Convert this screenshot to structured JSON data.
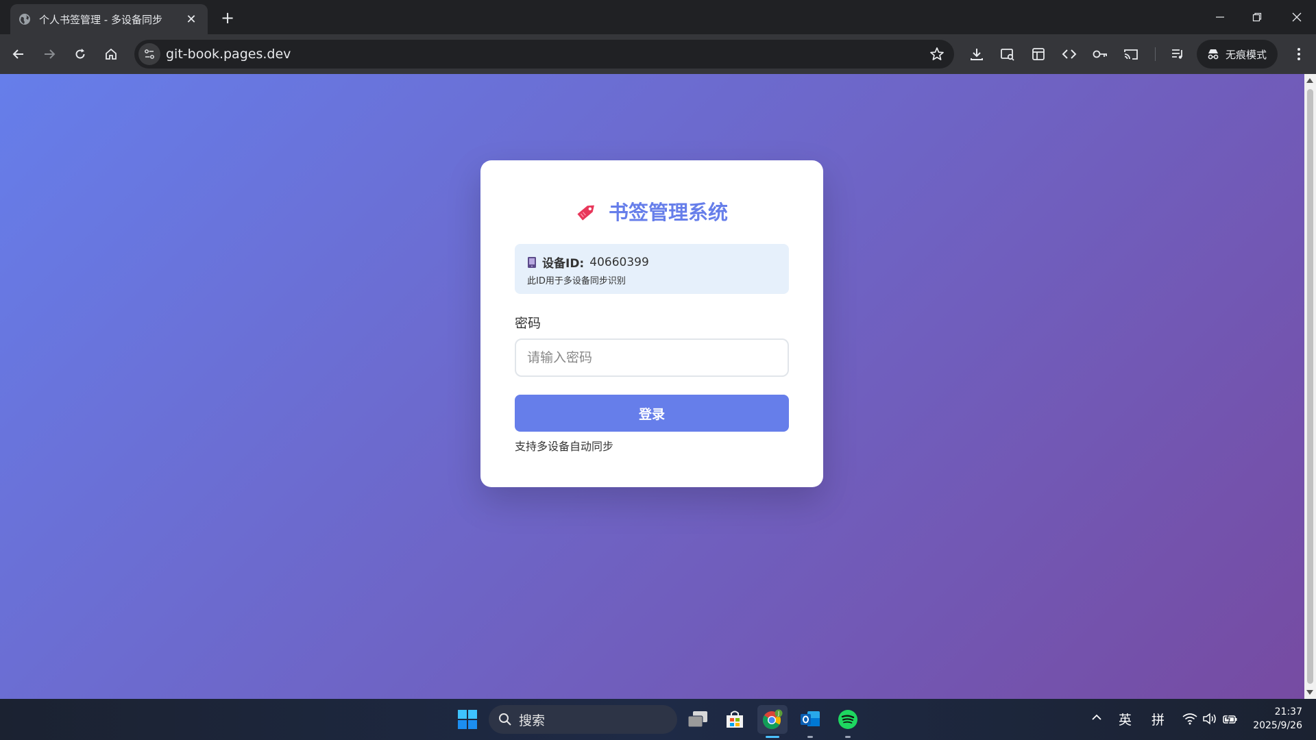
{
  "browser": {
    "tab_title": "个人书签管理 - 多设备同步",
    "url": "git-book.pages.dev",
    "incognito_label": "无痕模式"
  },
  "login": {
    "title": "书签管理系统",
    "title_icon": "bookmark-tag-icon",
    "device_label": "设备ID:",
    "device_id": "40660399",
    "device_note": "此ID用于多设备同步识别",
    "password_label": "密码",
    "password_placeholder": "请输入密码",
    "password_value": "",
    "login_button": "登录",
    "sync_note": "支持多设备自动同步"
  },
  "colors": {
    "gradient_start": "#667eea",
    "gradient_end": "#764ba2",
    "accent": "#667eea",
    "title_icon": "#e8375a"
  },
  "taskbar": {
    "search_placeholder": "搜索",
    "ime_lang": "英",
    "ime_mode": "拼",
    "time": "21:37",
    "date": "2025/9/26",
    "chrome_badge": "J"
  }
}
